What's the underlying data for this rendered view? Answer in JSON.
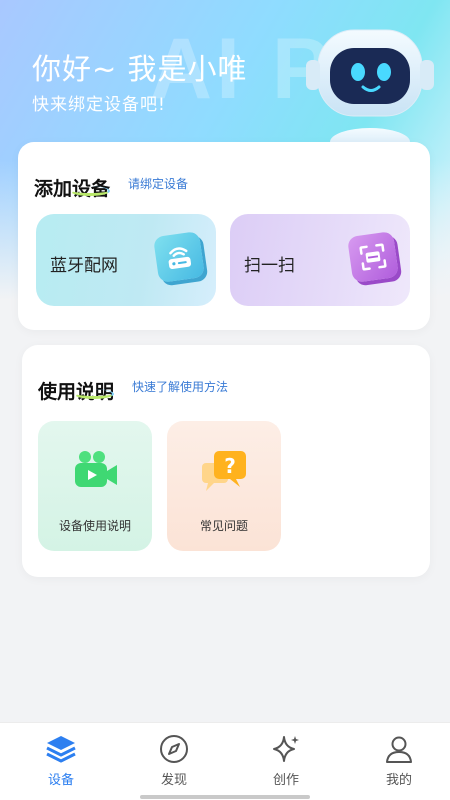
{
  "header": {
    "greeting": "你好~  我是小唯",
    "subgreeting": "快来绑定设备吧!",
    "watermark": "AI PK"
  },
  "add_device": {
    "title": "添加设备",
    "hint": "请绑定设备",
    "bluetooth_label": "蓝牙配网",
    "scan_label": "扫一扫"
  },
  "instructions": {
    "title": "使用说明",
    "hint": "快速了解使用方法",
    "items": [
      {
        "label": "设备使用说明",
        "icon": "video-camera-icon"
      },
      {
        "label": "常见问题",
        "icon": "question-chat-icon"
      }
    ]
  },
  "tabbar": {
    "items": [
      {
        "label": "设备",
        "icon": "layers-icon",
        "active": true
      },
      {
        "label": "发现",
        "icon": "compass-icon",
        "active": false
      },
      {
        "label": "创作",
        "icon": "sparkle-icon",
        "active": false
      },
      {
        "label": "我的",
        "icon": "person-icon",
        "active": false
      }
    ]
  },
  "colors": {
    "accent": "#2d7ff0",
    "hint": "#3a7bd5",
    "bluetooth_tile": "#bfe9f3",
    "scan_tile": "#e6dcf9"
  }
}
